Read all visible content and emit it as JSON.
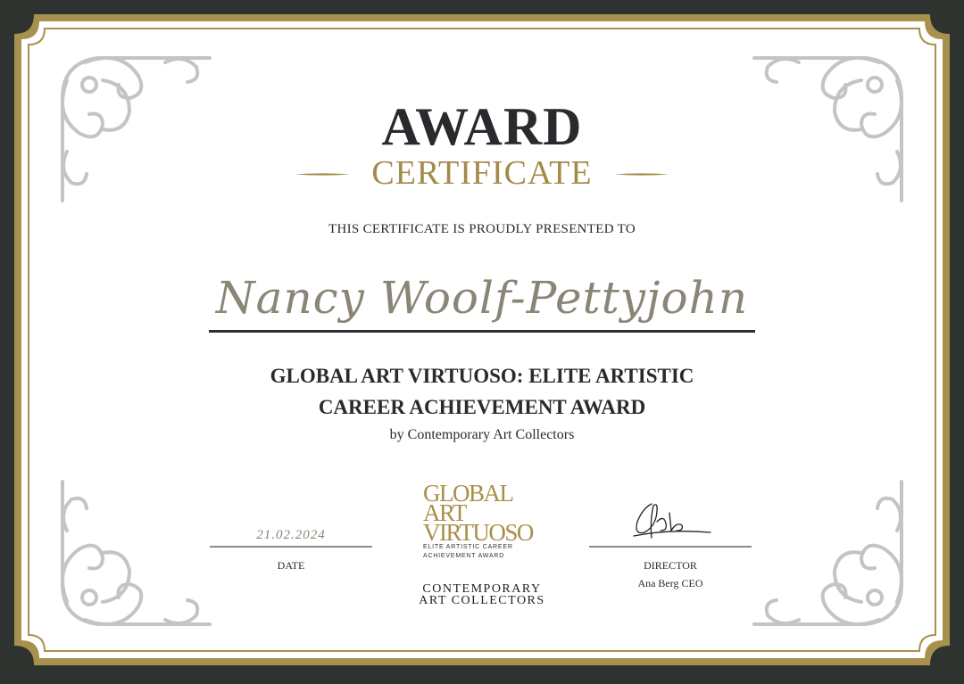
{
  "certificate": {
    "title_main": "AWARD",
    "title_sub": "CERTIFICATE",
    "presented_text": "THIS CERTIFICATE IS PROUDLY PRESENTED TO",
    "recipient_name": "Nancy Woolf-Pettyjohn",
    "award_title_line1": "GLOBAL ART VIRTUOSO: ELITE ARTISTIC",
    "award_title_line2": "CAREER ACHIEVEMENT AWARD",
    "award_by": "by Contemporary Art Collectors"
  },
  "signatures": {
    "date_value": "21.02.2024",
    "date_label": "DATE",
    "director_label": "DIRECTOR",
    "director_name": "Ana Berg CEO"
  },
  "logo": {
    "line1": "GLOBAL",
    "line2": "ART",
    "line3": "VIRTUOSO",
    "tagline1": "ELITE ARTISTIC CAREER",
    "tagline2": "ACHIEVEMENT AWARD"
  },
  "organization": {
    "line1": "CONTEMPORARY",
    "line2": "ART COLLECTORS"
  },
  "colors": {
    "background": "#2f3330",
    "gold": "#a38a4a",
    "paper": "#ffffff",
    "ornament": "#c4c4c4",
    "text": "#2a2a2e"
  },
  "icons": [
    "corner-ornament-icon",
    "signature-icon",
    "gold-divider-icon"
  ]
}
